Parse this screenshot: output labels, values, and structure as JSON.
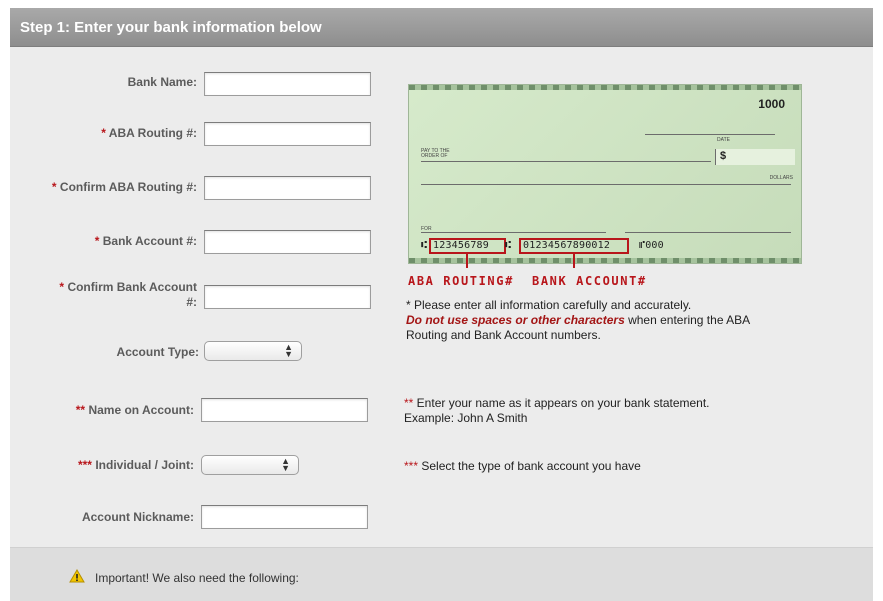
{
  "header": {
    "title": "Step 1: Enter your bank information below"
  },
  "form": {
    "bank_name_label": "Bank Name:",
    "aba_routing_label": "ABA Routing #:",
    "confirm_aba_routing_label": "Confirm ABA Routing #:",
    "bank_account_label": "Bank Account #:",
    "confirm_bank_account_label_line1": "Confirm Bank Account",
    "confirm_bank_account_label_line2": "#:",
    "account_type_label": "Account Type:",
    "name_on_account_label": "Name on Account:",
    "individual_joint_label": "Individual / Joint:",
    "account_nickname_label": "Account Nickname:",
    "required_single": "*",
    "required_double": "**",
    "required_triple": "***",
    "values": {
      "bank_name": "",
      "aba_routing": "",
      "confirm_aba_routing": "",
      "bank_account": "",
      "confirm_bank_account": "",
      "account_type": "",
      "name_on_account": "",
      "individual_joint": "",
      "account_nickname": ""
    }
  },
  "check": {
    "number": "1000",
    "date_label": "DATE",
    "pay_to_label": "PAY TO THE ORDER OF",
    "dollar_sign": "$",
    "dollars_label": "DOLLARS",
    "for_label": "FOR",
    "micr_prefix": "⑆",
    "routing_number": "123456789",
    "micr_separator": "⑆",
    "account_number": "01234567890012",
    "check_micr_number": "⑈000",
    "legend_routing": "ABA ROUTING#",
    "legend_account": "BANK ACCOUNT#",
    "accent_color": "#b8161b"
  },
  "notes": {
    "caution_line1": "* Please enter all information carefully and accurately.",
    "caution_emphasis": "Do not use spaces or other characters",
    "caution_rest": " when entering the ABA",
    "caution_line3": "Routing and Bank Account numbers.",
    "name_note_prefix": "**",
    "name_note_line1": " Enter your name as it appears on your bank statement.",
    "name_note_line2": "Example: John A Smith",
    "type_note_prefix": "***",
    "type_note": " Select the type of bank account you have"
  },
  "important": {
    "icon": "warning-icon",
    "text": "Important! We also need the following:"
  }
}
